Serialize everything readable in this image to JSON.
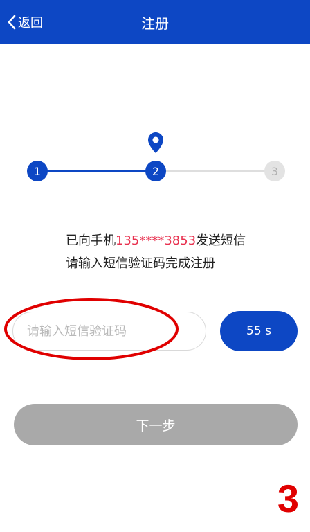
{
  "header": {
    "back_label": "返回",
    "title": "注册"
  },
  "stepper": {
    "steps": [
      "1",
      "2",
      "3"
    ],
    "current_step": 2
  },
  "message": {
    "prefix": "已向手机",
    "phone": "135****3853",
    "suffix": "发送短信",
    "line2": "请输入短信验证码完成注册"
  },
  "code_input": {
    "placeholder": "请输入短信验证码",
    "value": ""
  },
  "countdown_button": {
    "label": "55 s"
  },
  "next_button": {
    "label": "下一步",
    "enabled": false
  },
  "annotation": {
    "number": "3"
  },
  "colors": {
    "primary": "#0d47c4",
    "highlight": "#e8314f",
    "disabled": "#a9a9a9",
    "annotation": "#e00000"
  }
}
